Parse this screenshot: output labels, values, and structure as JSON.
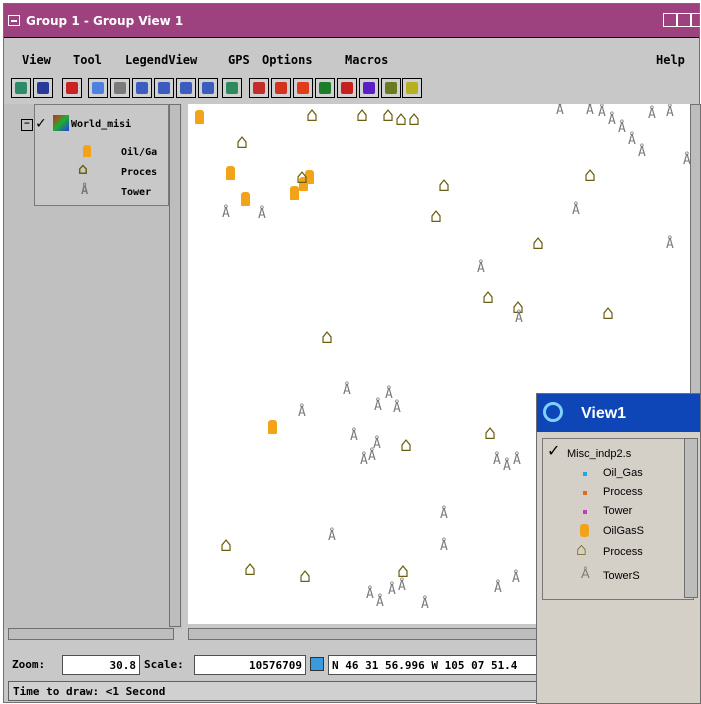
{
  "window": {
    "title": "Group 1 - Group View 1",
    "menus": [
      "View",
      "Tool",
      "LegendView",
      "GPS",
      "Options",
      "Macros"
    ],
    "help": "Help"
  },
  "toolbar_icons": [
    "view-icon",
    "square-icon",
    "pan-icon",
    "zoom-region-icon",
    "zoom-1x-icon",
    "zoom-in-icon",
    "zoom-out-icon",
    "zoom-box-icon",
    "zoom-full-icon",
    "select-icon",
    "draw-icon",
    "pointer-icon",
    "sketch-icon",
    "layer-icon",
    "ruler-icon",
    "measure-icon",
    "gps-icon"
  ],
  "legend": {
    "layer": "World_misi",
    "items": [
      "Oil/Ga",
      "Proces",
      "Tower"
    ]
  },
  "status": {
    "zoom_label": "Zoom:",
    "zoom_value": "30.8",
    "scale_label": "Scale:",
    "scale_value": "10576709",
    "coords": "N 46 31 56.996  W 105 07 51.4",
    "time_to_draw": "Time to draw: <1 Second"
  },
  "view1": {
    "title": "View1",
    "layer": "Misc_indp2.s",
    "items": [
      "Oil_Gas",
      "Process",
      "Tower",
      "OilGasS",
      "Process",
      "TowerS"
    ]
  },
  "colors": {
    "titlebar": "#9d427f",
    "view1_title": "#0e45b7",
    "house": "#6b5f12",
    "drum": "#f3a31a",
    "tower": "#7a7a7a"
  }
}
